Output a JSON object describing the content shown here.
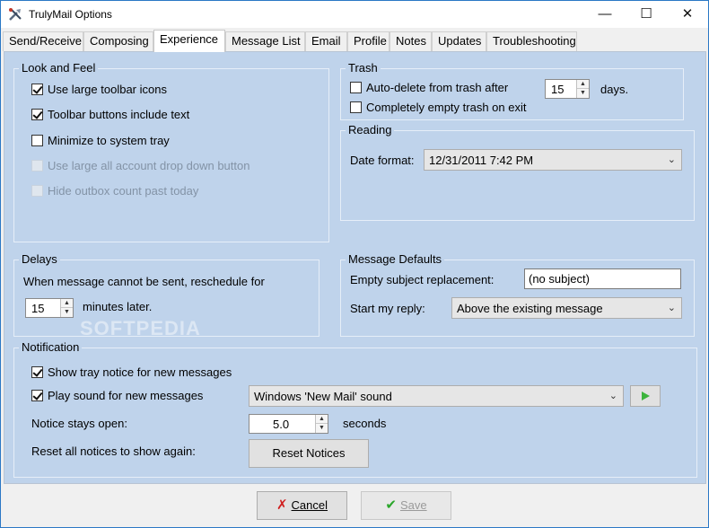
{
  "window": {
    "title": "TrulyMail Options",
    "min": "—",
    "max": "☐",
    "close": "✕"
  },
  "tabs": [
    "Send/Receive",
    "Composing",
    "Experience",
    "Message List",
    "Email",
    "Profile",
    "Notes",
    "Updates",
    "Troubleshooting"
  ],
  "active_tab": "Experience",
  "look_and_feel": {
    "label": "Look and Feel",
    "options": [
      {
        "label": "Use large toolbar icons",
        "checked": true,
        "enabled": true
      },
      {
        "label": "Toolbar buttons include text",
        "checked": true,
        "enabled": true
      },
      {
        "label": "Minimize to system tray",
        "checked": false,
        "enabled": true
      },
      {
        "label": "Use large all account drop down button",
        "checked": false,
        "enabled": false
      },
      {
        "label": "Hide outbox count past today",
        "checked": false,
        "enabled": false
      }
    ]
  },
  "trash": {
    "label": "Trash",
    "auto_delete_label": "Auto-delete from trash after",
    "auto_delete_checked": false,
    "days_value": "15",
    "days_suffix": "days.",
    "empty_on_exit_label": "Completely empty trash on exit",
    "empty_on_exit_checked": false
  },
  "reading": {
    "label": "Reading",
    "date_format_label": "Date format:",
    "date_format_value": "12/31/2011 7:42 PM"
  },
  "delays": {
    "label": "Delays",
    "text": "When message cannot be sent, reschedule for",
    "minutes_value": "15",
    "minutes_suffix": "minutes later."
  },
  "message_defaults": {
    "label": "Message Defaults",
    "empty_subject_label": "Empty subject replacement:",
    "empty_subject_value": "(no subject)",
    "reply_label": "Start my reply:",
    "reply_value": "Above the existing message"
  },
  "notification": {
    "label": "Notification",
    "tray_notice_label": "Show tray notice for new messages",
    "tray_notice_checked": true,
    "play_sound_label": "Play sound for new messages",
    "play_sound_checked": true,
    "sound_value": "Windows 'New Mail' sound",
    "notice_open_label": "Notice stays open:",
    "notice_open_value": "5.0",
    "notice_open_suffix": "seconds",
    "reset_label": "Reset all notices to show again:",
    "reset_button": "Reset Notices"
  },
  "footer": {
    "cancel": "Cancel",
    "save": "Save"
  },
  "watermark": "SOFTPEDIA",
  "colors": {
    "panel": "#bfd3eb",
    "play": "#3cb43c",
    "save_check": "#2aa62a",
    "cancel_x": "#d02020"
  }
}
